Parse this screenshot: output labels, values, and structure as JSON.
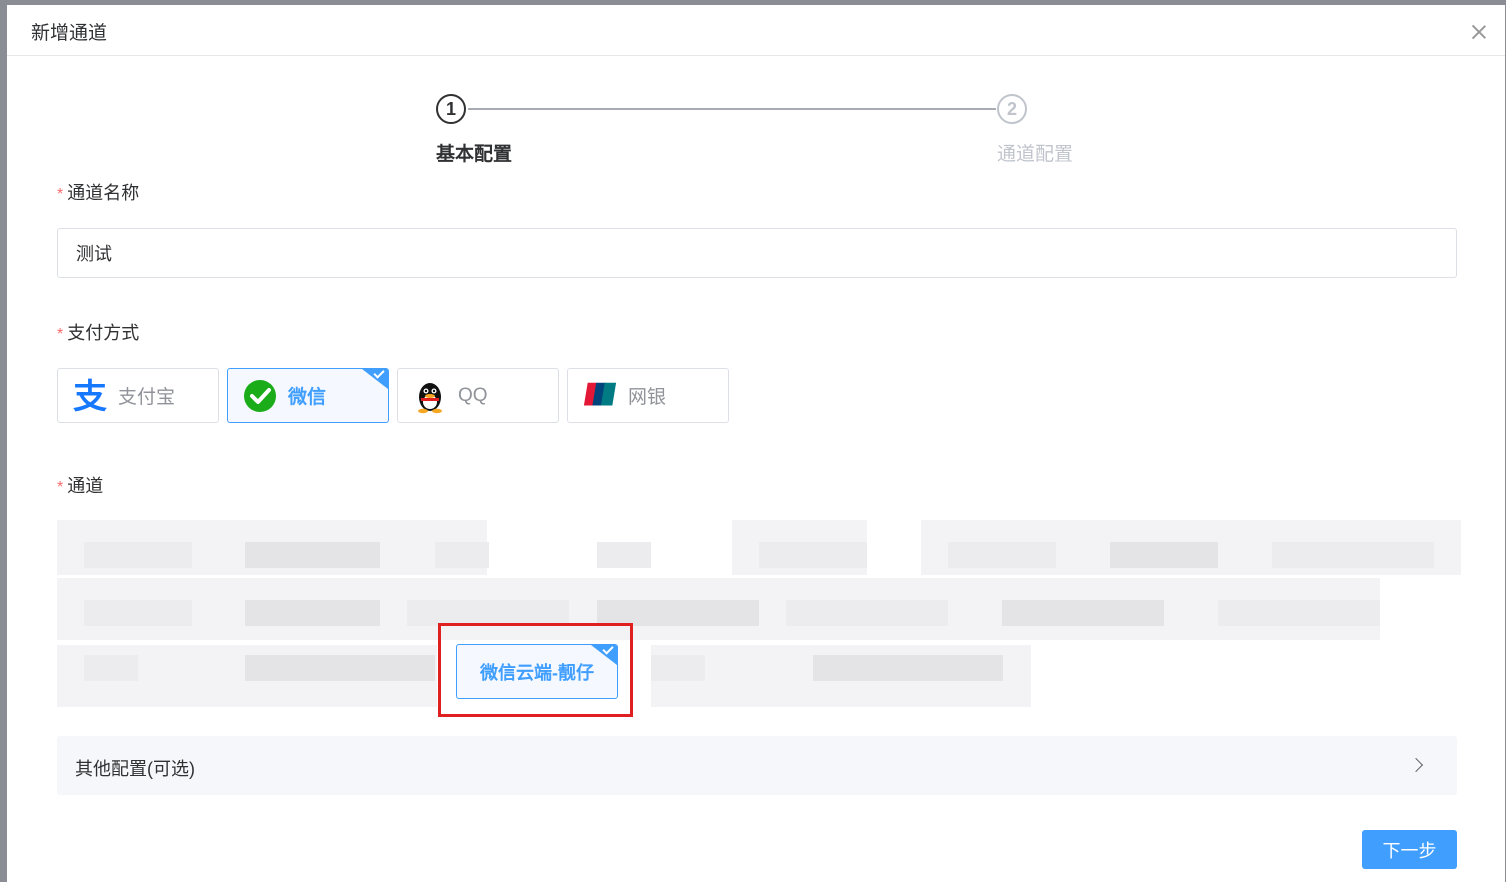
{
  "modal": {
    "title": "新增通道"
  },
  "steps": [
    {
      "number": "1",
      "label": "基本配置",
      "status": "active"
    },
    {
      "number": "2",
      "label": "通道配置",
      "status": "pending"
    }
  ],
  "form": {
    "name_label": "通道名称",
    "name_value": "测试",
    "pay_label": "支付方式",
    "channel_label": "通道",
    "required_mark": "*"
  },
  "pay_methods": [
    {
      "label": "支付宝",
      "icon": "alipay-icon",
      "selected": false
    },
    {
      "label": "微信",
      "icon": "wechat-icon",
      "selected": true
    },
    {
      "label": "QQ",
      "icon": "qq-icon",
      "selected": false
    },
    {
      "label": "网银",
      "icon": "unionpay-icon",
      "selected": false
    }
  ],
  "channels": {
    "selected_label": "微信云端-靓仔"
  },
  "collapse": {
    "label": "其他配置(可选)"
  },
  "footer": {
    "next_label": "下一步"
  },
  "colors": {
    "primary": "#409eff",
    "required": "#f56c6c",
    "highlight": "#e02020"
  }
}
